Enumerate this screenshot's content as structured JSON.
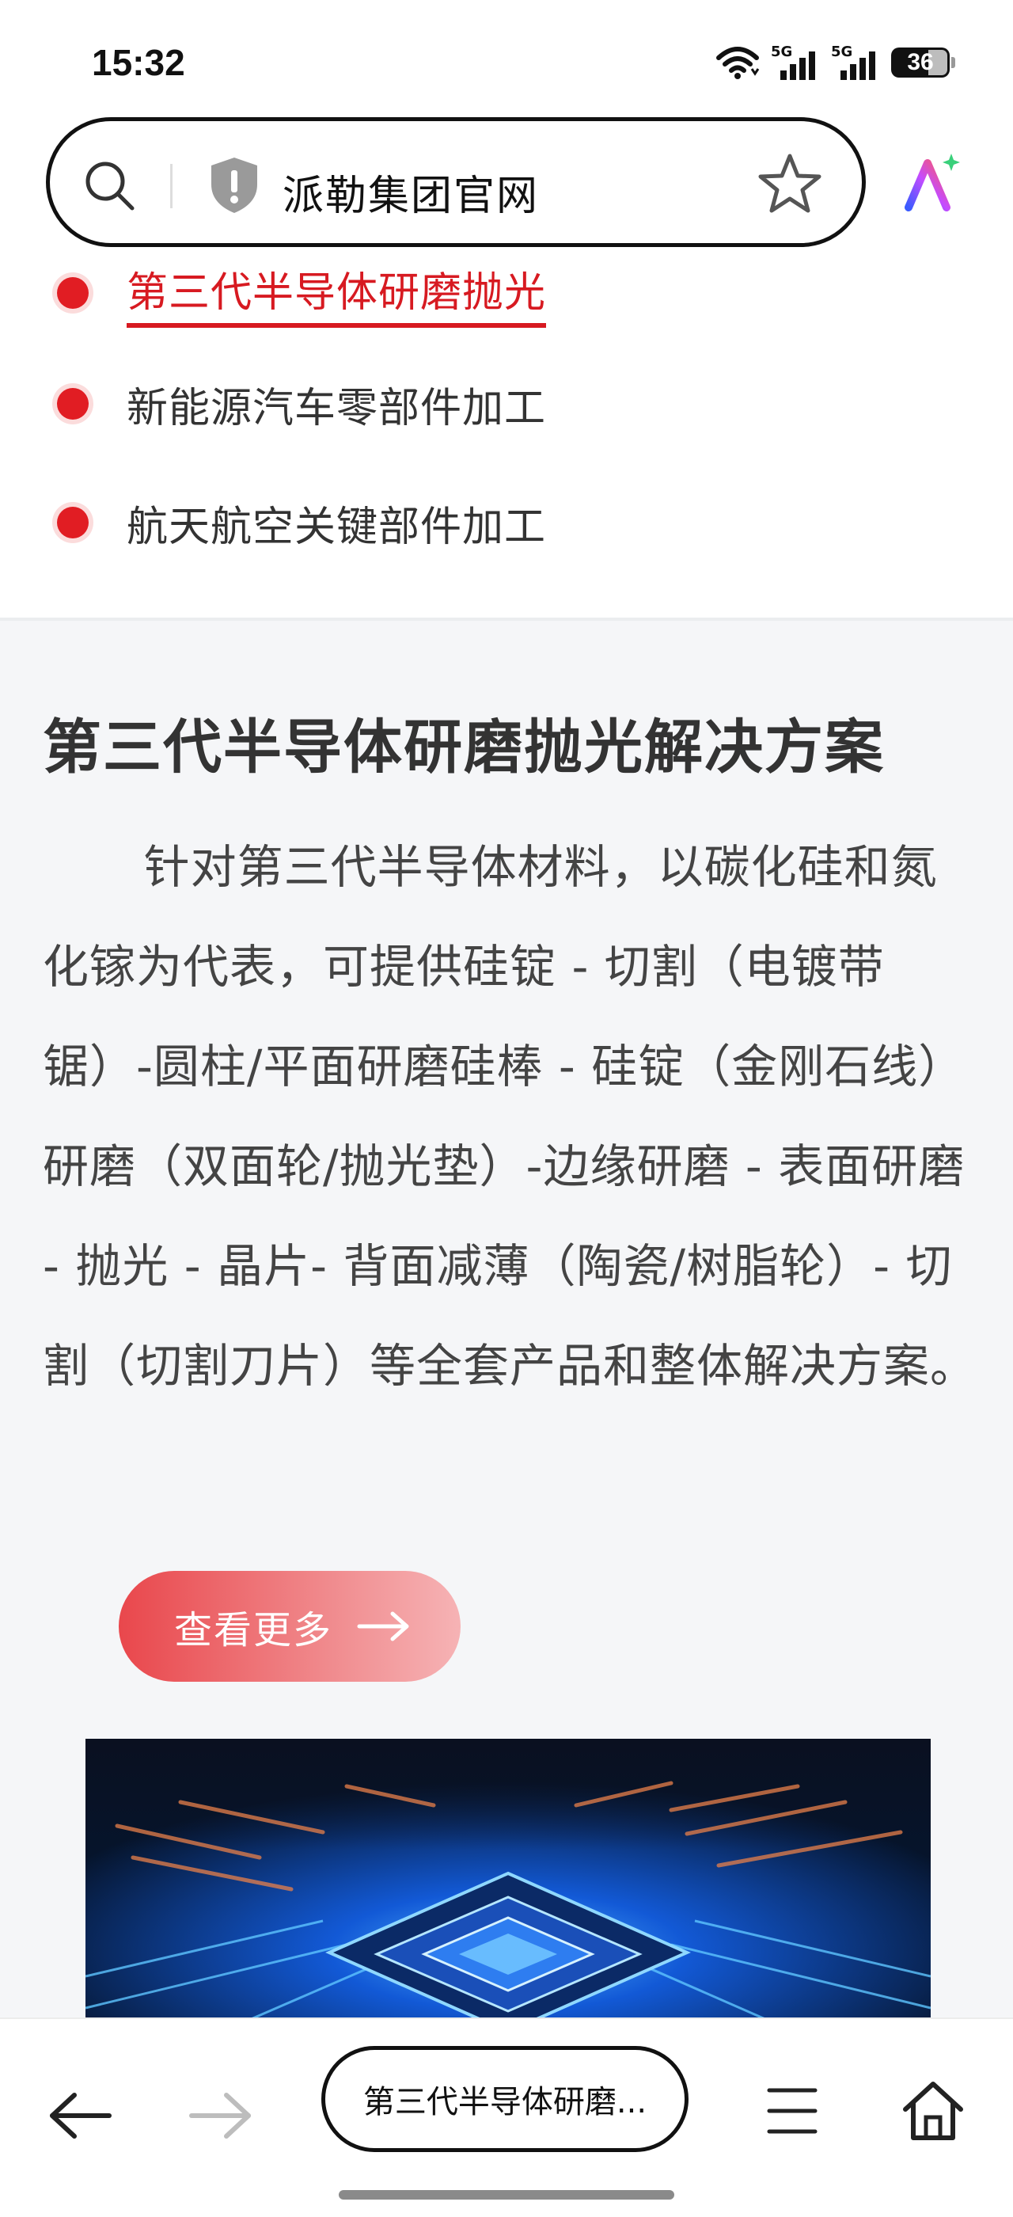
{
  "status_bar": {
    "time": "15:32",
    "network_1": "5G",
    "network_2": "5G",
    "battery": "36"
  },
  "address_bar": {
    "site_name": "派勒集团官网",
    "icons": [
      "search-icon",
      "shield-icon",
      "star-icon",
      "ai-assistant-icon"
    ]
  },
  "list": {
    "items": [
      {
        "label": "第三代半导体研磨抛光",
        "active": true
      },
      {
        "label": "新能源汽车零部件加工",
        "active": false
      },
      {
        "label": "航天航空关键部件加工",
        "active": false
      }
    ],
    "accent_color": "#d71a21"
  },
  "main": {
    "title": "第三代半导体研磨抛光解决方案",
    "description": "针对第三代半导体材料，以碳化硅和氮化镓为代表，可提供硅锭 - 切割（电镀带锯）-圆柱/平面研磨硅棒 - 硅锭（金刚石线）研磨（双面轮/抛光垫）-边缘研磨 - 表面研磨 - 抛光 - 晶片- 背面减薄（陶瓷/树脂轮）- 切割（切割刀片）等全套产品和整体解决方案。",
    "more_button": "查看更多"
  },
  "bottom_nav": {
    "tab_title": "第三代半导体研磨...",
    "icons": [
      "back-arrow-icon",
      "forward-arrow-icon",
      "menu-icon",
      "home-icon"
    ]
  }
}
